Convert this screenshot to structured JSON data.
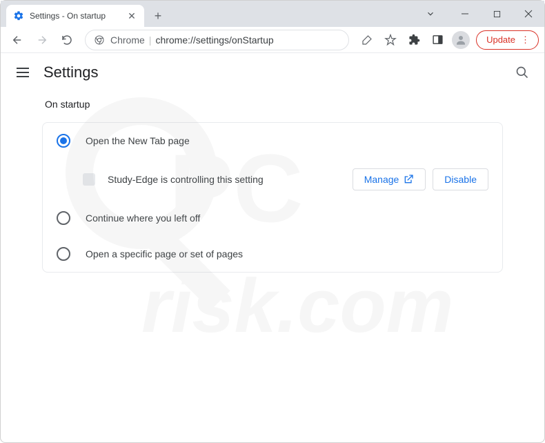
{
  "window": {
    "tab_title": "Settings - On startup"
  },
  "omnibox": {
    "scheme_label": "Chrome",
    "path": "chrome://settings/onStartup"
  },
  "update_button": "Update",
  "header": {
    "title": "Settings"
  },
  "section": {
    "title": "On startup",
    "options": {
      "new_tab": "Open the New Tab page",
      "continue": "Continue where you left off",
      "specific": "Open a specific page or set of pages"
    },
    "extension_notice": "Study-Edge is controlling this setting",
    "manage_label": "Manage",
    "disable_label": "Disable"
  }
}
